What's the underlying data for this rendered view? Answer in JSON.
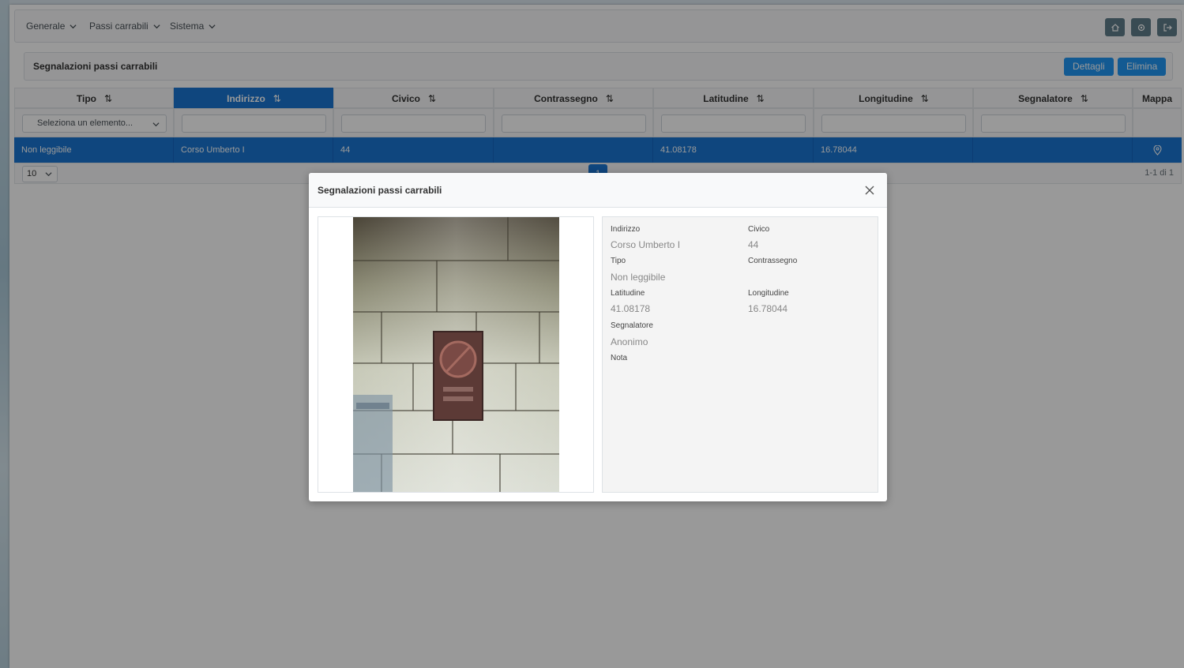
{
  "menu": {
    "items": [
      {
        "label": "Generale"
      },
      {
        "label": "Passi carrabili"
      },
      {
        "label": "Sistema"
      }
    ]
  },
  "toolbar": {
    "icons": [
      "home-icon",
      "gear-icon",
      "logout-icon"
    ],
    "color": "#607d8b"
  },
  "section": {
    "title": "Segnalazioni passi carrabili",
    "details_label": "Dettagli",
    "delete_label": "Elimina",
    "accent": "#2196f3"
  },
  "table": {
    "columns": [
      {
        "label": "Tipo",
        "sort": "⇅"
      },
      {
        "label": "Indirizzo",
        "sort": "⇅"
      },
      {
        "label": "Civico",
        "sort": "⇅"
      },
      {
        "label": "Contrassegno",
        "sort": "⇅"
      },
      {
        "label": "Latitudine",
        "sort": "⇅"
      },
      {
        "label": "Longitudine",
        "sort": "⇅"
      },
      {
        "label": "Segnalatore",
        "sort": "⇅"
      },
      {
        "label": "Mappa",
        "sort": ""
      }
    ],
    "type_filter_placeholder": "Seleziona un elemento...",
    "rows": [
      {
        "tipo": "Non leggibile",
        "indirizzo": "Corso Umberto I",
        "civico": "44",
        "contrassegno": "",
        "latitudine": "41.08178",
        "longitudine": "16.78044",
        "segnalatore": ""
      }
    ],
    "rows_per_page": "10",
    "current_page": "1",
    "report": "1-1 di 1",
    "selected_color": "#1976d2"
  },
  "dialog": {
    "title": "Segnalazioni passi carrabili",
    "fields": {
      "indirizzo": {
        "label": "Indirizzo",
        "value": "Corso Umberto I"
      },
      "civico": {
        "label": "Civico",
        "value": "44"
      },
      "tipo": {
        "label": "Tipo",
        "value": "Non leggibile"
      },
      "contrassegno": {
        "label": "Contrassegno",
        "value": ""
      },
      "latitudine": {
        "label": "Latitudine",
        "value": "41.08178"
      },
      "longitudine": {
        "label": "Longitudine",
        "value": "16.78044"
      },
      "segnalatore": {
        "label": "Segnalatore",
        "value": "Anonimo"
      },
      "nota": {
        "label": "Nota",
        "value": ""
      }
    }
  }
}
